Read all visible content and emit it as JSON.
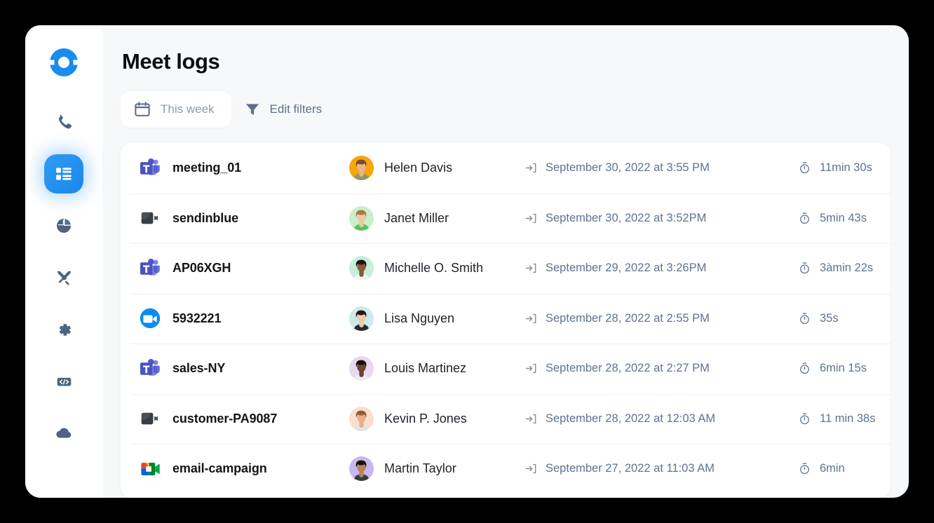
{
  "window": {
    "background_color": "#000000",
    "surface_color": "#f7f8fa",
    "accent_color": "#1a86ea"
  },
  "sidebar": {
    "logo_name": "ringover-logo",
    "items": [
      {
        "icon": "phone-icon",
        "name": "calls",
        "active": false
      },
      {
        "icon": "list-icon",
        "name": "logs",
        "active": true
      },
      {
        "icon": "pie-chart-icon",
        "name": "stats",
        "active": false
      },
      {
        "icon": "crossed-swords-icon",
        "name": "campaigns",
        "active": false
      },
      {
        "icon": "gear-icon",
        "name": "settings",
        "active": false
      },
      {
        "icon": "code-icon",
        "name": "developer",
        "active": false
      },
      {
        "icon": "cloud-icon",
        "name": "cloud",
        "active": false
      }
    ]
  },
  "header": {
    "title": "Meet logs"
  },
  "toolbar": {
    "date_filter_label": "This week",
    "date_filter_icon": "calendar-icon",
    "edit_filters_label": "Edit filters",
    "edit_filters_icon": "funnel-icon"
  },
  "table": {
    "date_icon": "login-arrow-icon",
    "duration_icon": "stopwatch-icon",
    "rows": [
      {
        "platform": "microsoft-teams",
        "meeting": "meeting_01",
        "person": "Helen Davis",
        "avatar_bg": "#f6a609",
        "skin": "#e8b48f",
        "hair": "#7a4a2b",
        "shirt": "#8c9a6b",
        "date": "September 30, 2022 at 3:55 PM",
        "duration": "11min 30s"
      },
      {
        "platform": "camera",
        "meeting": "sendinblue",
        "person": "Janet Miller",
        "avatar_bg": "#c9eecd",
        "skin": "#f0c7a4",
        "hair": "#b0763e",
        "shirt": "#59c35e",
        "date": "September 30, 2022 at 3:52PM",
        "duration": "5min 43s"
      },
      {
        "platform": "microsoft-teams",
        "meeting": "AP06XGH",
        "person": "Michelle O. Smith",
        "avatar_bg": "#c6eedb",
        "skin": "#8a5a3a",
        "hair": "#20160f",
        "shirt": "#f2f2f2",
        "date": "September 29, 2022 at 3:26PM",
        "duration": "3àmin 22s"
      },
      {
        "platform": "zoom",
        "meeting": "5932221",
        "person": "Lisa Nguyen",
        "avatar_bg": "#cdeaec",
        "skin": "#f0cbaa",
        "hair": "#241a14",
        "shirt": "#2b2b2f",
        "date": "September 28, 2022 at 2:55 PM",
        "duration": "35s"
      },
      {
        "platform": "microsoft-teams",
        "meeting": "sales-NY",
        "person": "Louis  Martinez",
        "avatar_bg": "#e8d8f2",
        "skin": "#6b4530",
        "hair": "#17100c",
        "shirt": "#ededed",
        "date": "September 28, 2022 at 2:27 PM",
        "duration": "6min 15s"
      },
      {
        "platform": "camera",
        "meeting": "customer-PA9087",
        "person": "Kevin P. Jones",
        "avatar_bg": "#fadfce",
        "skin": "#e8b089",
        "hair": "#9a5a32",
        "shirt": "#e3e3e3",
        "date": "September 28, 2022 at 12:03 AM",
        "duration": "11 min 38s"
      },
      {
        "platform": "google-meet",
        "meeting": "email-campaign",
        "person": "Martin Taylor",
        "avatar_bg": "#c9b8ef",
        "skin": "#b9825a",
        "hair": "#14100d",
        "shirt": "#3a3a44",
        "date": "September 27, 2022 at 11:03 AM",
        "duration": "6min"
      }
    ]
  }
}
